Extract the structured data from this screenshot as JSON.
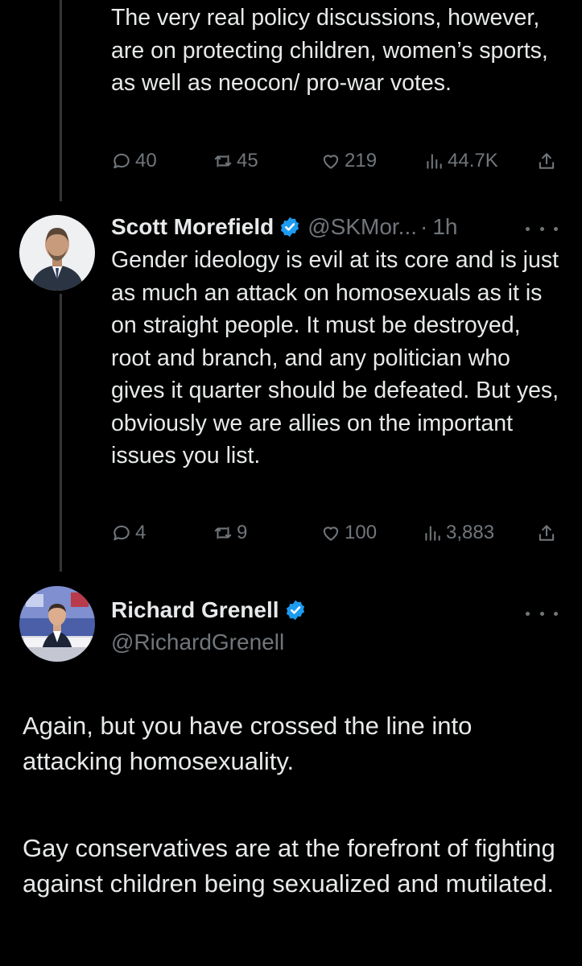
{
  "tweet1": {
    "text": "The very real policy discussions, however, are on protecting children, women’s sports, as well as neocon/ pro-war votes.",
    "replies": "40",
    "retweets": "45",
    "likes": "219",
    "views": "44.7K"
  },
  "tweet2": {
    "name": "Scott Morefield",
    "handle": "@SKMor...",
    "separator": "·",
    "time": "1h",
    "text": "Gender ideology is evil at its core and is just as much an attack on homosexuals as it is on straight people. It must be destroyed, root and branch, and any politician who gives it quarter should be defeated. But yes, obviously we are allies on the important issues you list.",
    "replies": "4",
    "retweets": "9",
    "likes": "100",
    "views": "3,883"
  },
  "tweet3": {
    "name": "Richard Grenell",
    "handle": "@RichardGrenell",
    "paragraph1": "Again, but you have crossed the line into attacking homosexuality.",
    "paragraph2": "Gay conservatives are at the forefront of fighting against children being sexualized and mutilated."
  },
  "colors": {
    "background": "#000000",
    "text": "#e7e9ea",
    "muted": "#71767b",
    "verified": "#1d9bf0",
    "thread_line": "#333639"
  },
  "icons": [
    "reply-icon",
    "retweet-icon",
    "like-icon",
    "views-icon",
    "share-icon",
    "verified-badge-icon",
    "more-icon"
  ]
}
